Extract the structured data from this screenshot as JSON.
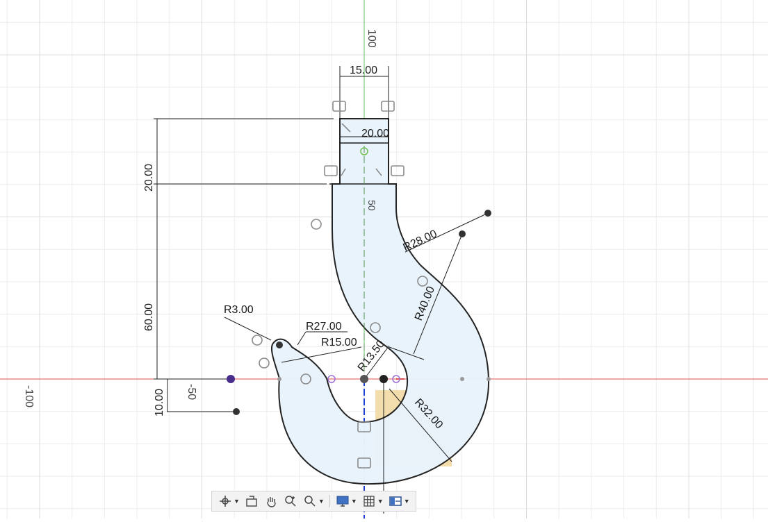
{
  "axes": {
    "y_axis_label": "100",
    "x_axis_label": "-100",
    "origin_x_tick": "-50",
    "origin_y_tick": "50"
  },
  "dimensions": {
    "shank_top_width": "15.00",
    "shank_mid_width": "20.00",
    "shank_height": "20.00",
    "shank_length": "60.00",
    "offset": "10.00",
    "r_outer_bend": "R28.00",
    "r_outer_hook": "R40.00",
    "r_tip": "R3.00",
    "r_inner_1": "R27.00",
    "r_inner_2": "R15.00",
    "r_throat": "R13.50",
    "r_bottom": "R32.00"
  },
  "colors": {
    "grid": "#e7e7e7",
    "x_axis": "#e0504f",
    "y_axis": "#5cc45c",
    "profile_fill": "#e9f3fb",
    "profile_stroke": "#1f1f1f",
    "highlight": "#f2d79e"
  },
  "navbar": {
    "items": [
      {
        "name": "orbit-icon",
        "caret": true
      },
      {
        "name": "look-at-icon",
        "caret": false
      },
      {
        "name": "pan-icon",
        "caret": false
      },
      {
        "name": "zoom-icon",
        "caret": false
      },
      {
        "name": "fit-icon",
        "caret": true
      },
      {
        "name": "display-settings-icon",
        "caret": true
      },
      {
        "name": "grid-settings-icon",
        "caret": true
      },
      {
        "name": "viewports-icon",
        "caret": true
      }
    ]
  }
}
